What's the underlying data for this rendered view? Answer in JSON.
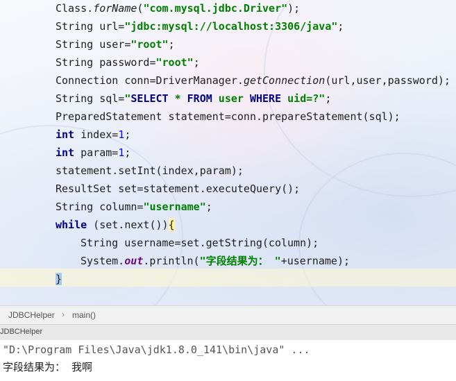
{
  "editor": {
    "lines": [
      {
        "parts": [
          [
            "",
            "Class."
          ],
          [
            "ital",
            "forName"
          ],
          [
            "",
            "("
          ],
          [
            "str",
            "\"com.mysql.jdbc.Driver\""
          ],
          [
            "",
            ");"
          ]
        ]
      },
      {
        "parts": [
          [
            "",
            "String url="
          ],
          [
            "str",
            "\"jdbc:mysql://localhost:3306/java\""
          ],
          [
            "",
            ";"
          ]
        ]
      },
      {
        "parts": [
          [
            "",
            "String user="
          ],
          [
            "str",
            "\"root\""
          ],
          [
            "",
            ";"
          ]
        ]
      },
      {
        "parts": [
          [
            "",
            "String password="
          ],
          [
            "str",
            "\"root\""
          ],
          [
            "",
            ";"
          ]
        ]
      },
      {
        "parts": [
          [
            "",
            "Connection conn=DriverManager."
          ],
          [
            "ital",
            "getConnection"
          ],
          [
            "",
            "(url,user,password);"
          ]
        ]
      },
      {
        "parts": [
          [
            "",
            "String sql="
          ],
          [
            "str",
            "\""
          ],
          [
            "sqlkw",
            "SELECT"
          ],
          [
            "str",
            " * "
          ],
          [
            "sqlkw",
            "FROM"
          ],
          [
            "str",
            " user "
          ],
          [
            "sqlkw",
            "WHERE"
          ],
          [
            "str",
            " uid=?\""
          ],
          [
            "",
            ";"
          ]
        ]
      },
      {
        "parts": [
          [
            "",
            "PreparedStatement statement=conn.prepareStatement(sql);"
          ]
        ]
      },
      {
        "parts": [
          [
            "kw",
            "int"
          ],
          [
            "",
            " index="
          ],
          [
            "num",
            "1"
          ],
          [
            "",
            ";"
          ]
        ]
      },
      {
        "parts": [
          [
            "kw",
            "int"
          ],
          [
            "",
            " param="
          ],
          [
            "num",
            "1"
          ],
          [
            "",
            ";"
          ]
        ]
      },
      {
        "parts": [
          [
            "",
            "statement.setInt(index,param);"
          ]
        ]
      },
      {
        "parts": [
          [
            "",
            "ResultSet set=statement.executeQuery();"
          ]
        ]
      },
      {
        "parts": [
          [
            "",
            "String column="
          ],
          [
            "str",
            "\"username\""
          ],
          [
            "",
            ";"
          ]
        ]
      },
      {
        "parts": [
          [
            "kw",
            "while"
          ],
          [
            "",
            " (set.next())"
          ],
          [
            "brace-hl",
            "{"
          ]
        ]
      },
      {
        "parts": [
          [
            "",
            "String username=set.getString(column);"
          ]
        ],
        "indent": true
      },
      {
        "parts": [
          [
            "",
            "System."
          ],
          [
            "field",
            "out"
          ],
          [
            "",
            ".println("
          ],
          [
            "str",
            "\"字段结果为： \""
          ],
          [
            "",
            "+username);"
          ]
        ],
        "indent": true
      },
      {
        "parts": [
          [
            "caret-brace",
            "}"
          ]
        ]
      }
    ]
  },
  "breadcrumb": {
    "items": [
      "JDBCHelper",
      "main()"
    ],
    "separator": "›"
  },
  "run_panel": {
    "title": "JDBCHelper"
  },
  "console": {
    "command": "\"D:\\Program Files\\Java\\jdk1.8.0_141\\bin\\java\" ...",
    "output": "字段结果为： 我啊"
  }
}
